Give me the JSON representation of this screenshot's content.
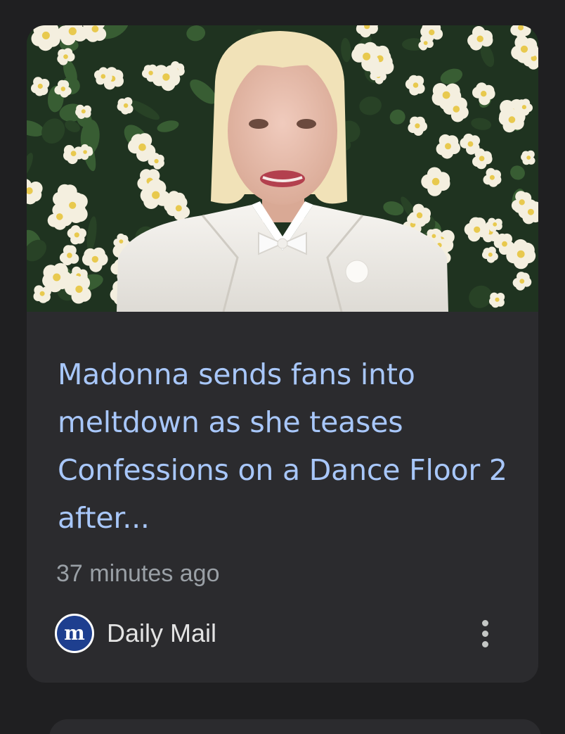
{
  "article": {
    "image_alt": "Madonna in a white suit with bow tie in front of a wall of white flowers",
    "headline": "Madonna sends fans into meltdown as she teases Confessions on a Dance Floor 2 after...",
    "timestamp": "37 minutes ago",
    "source": {
      "name": "Daily Mail",
      "logo_icon": "daily-mail-logo-icon",
      "logo_glyph": "m"
    },
    "more_icon": "more-vert-icon"
  },
  "colors": {
    "background": "#1f1f21",
    "card": "#2b2b2e",
    "headline": "#a8c7fa",
    "timestamp": "#9aa0a6",
    "source_text": "#e3e3e3",
    "logo_bg": "#1e3f8f"
  }
}
